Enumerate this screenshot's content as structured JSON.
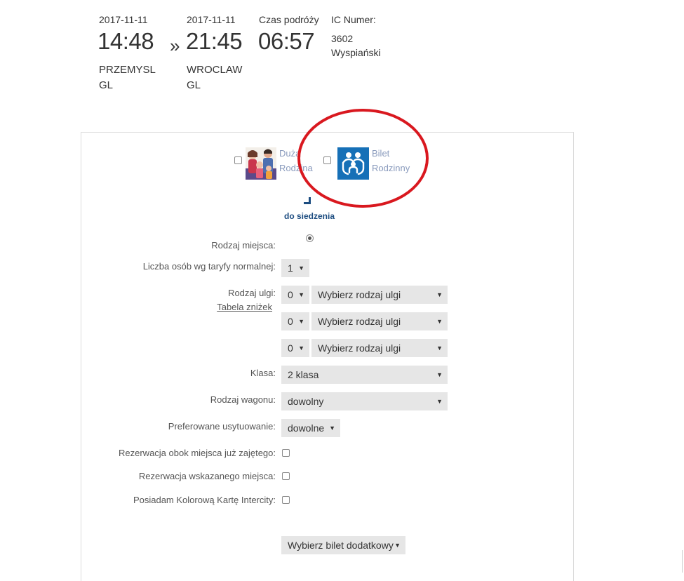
{
  "journey": {
    "departure": {
      "date": "2017-11-11",
      "time": "14:48",
      "station_line1": "PRZEMYSL",
      "station_line2": "GL"
    },
    "separator": "»",
    "arrival": {
      "date": "2017-11-11",
      "time": "21:45",
      "station_line1": "WROCLAW",
      "station_line2": "GL"
    },
    "travel_time": {
      "label": "Czas podróży",
      "value": "06:57"
    },
    "train": {
      "label": "IC Numer:",
      "number": "3602",
      "name": "Wyspiański"
    }
  },
  "offers": {
    "duza_rodzina": {
      "line1": "Duża",
      "line2": "Rodzina"
    },
    "bilet_rodzinny": {
      "line1": "Bilet",
      "line2": "Rodzinny"
    }
  },
  "seat_link": "do siedzenia",
  "form": {
    "seat_type_label": "Rodzaj miejsca:",
    "persons_label": "Liczba osób wg taryfy normalnej:",
    "persons_value": "1",
    "discount_label": "Rodzaj ulgi:",
    "discount_table_link": "Tabela zniżek",
    "discount_rows": [
      {
        "count": "0",
        "type": "Wybierz rodzaj ulgi"
      },
      {
        "count": "0",
        "type": "Wybierz rodzaj ulgi"
      },
      {
        "count": "0",
        "type": "Wybierz rodzaj ulgi"
      }
    ],
    "class_label": "Klasa:",
    "class_value": "2 klasa",
    "wagon_label": "Rodzaj wagonu:",
    "wagon_value": "dowolny",
    "position_label": "Preferowane usytuowanie:",
    "position_value": "dowolne",
    "next_to_occupied_label": "Rezerwacja obok miejsca już zajętego:",
    "indicated_seat_label": "Rezerwacja wskazanego miejsca:",
    "intercity_card_label": "Posiadam Kolorową Kartę Intercity:",
    "extra_ticket_value": "Wybierz bilet dodatkowy"
  },
  "colors": {
    "highlight_circle": "#d9181f",
    "offer_label": "#8a9bbd",
    "bilet_icon_bg": "#1670b7",
    "link_blue": "#1c4c80",
    "select_bg": "#e6e6e6"
  }
}
